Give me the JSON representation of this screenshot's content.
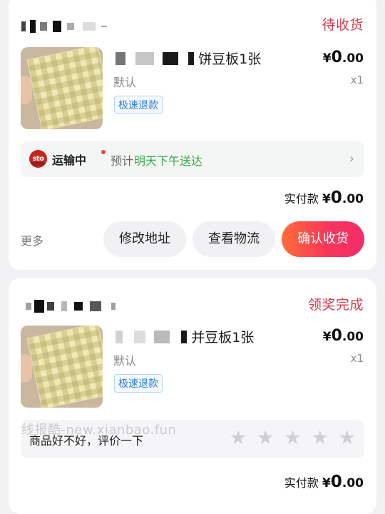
{
  "orders": [
    {
      "status": "待收货",
      "product": {
        "title_visible": "饼豆板1张",
        "price_symbol": "¥",
        "price_int": "0",
        "price_dec": ".00",
        "variant": "默认",
        "quantity": "x1",
        "tag": "极速退款"
      },
      "shipping": {
        "carrier_logo": "sto",
        "status": "运输中",
        "eta_prefix": "预计",
        "eta": "明天下午送达"
      },
      "paid": {
        "label": "实付款",
        "symbol": "¥",
        "amount_int": "0",
        "amount_dec": ".00"
      },
      "actions": {
        "more": "更多",
        "modify_address": "修改地址",
        "view_logistics": "查看物流",
        "confirm_receipt": "确认收货"
      }
    },
    {
      "status": "领奖完成",
      "product": {
        "title_visible": "并豆板1张",
        "price_symbol": "¥",
        "price_int": "0",
        "price_dec": ".00",
        "variant": "默认",
        "quantity": "x1",
        "tag": "极速退款"
      },
      "review": {
        "prompt": "商品好不好，评价一下",
        "stars": 5
      },
      "paid": {
        "label": "实付款",
        "symbol": "¥",
        "amount_int": "0",
        "amount_dec": ".00"
      }
    }
  ],
  "watermark": "线报酷-new.xianbao.fun",
  "colors": {
    "status_red": "#d23b4f",
    "tag_blue": "#2b7bd6",
    "eta_green": "#3aaa45",
    "button_gradient_start": "#ff6d3a",
    "button_gradient_end": "#f02d6a"
  }
}
